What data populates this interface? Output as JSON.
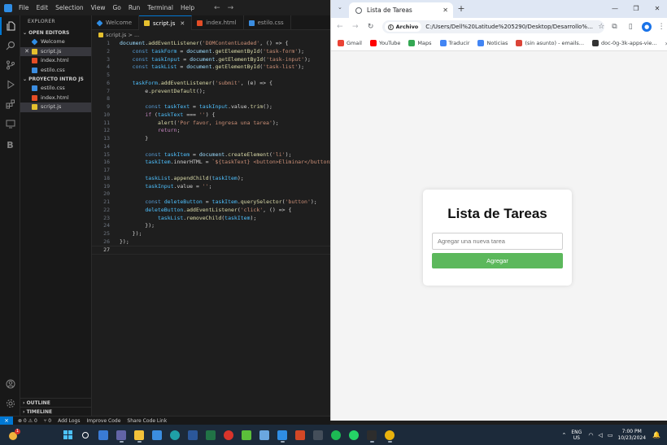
{
  "vscode": {
    "menu": [
      "File",
      "Edit",
      "Selection",
      "View",
      "Go",
      "Run",
      "Terminal",
      "Help"
    ],
    "nav": [
      "←",
      "→"
    ],
    "explorer_title": "EXPLORER",
    "open_editors_title": "OPEN EDITORS",
    "open_editors": [
      {
        "name": "Welcome",
        "icon": "vscode",
        "selected": false,
        "close": false
      },
      {
        "name": "script.js",
        "icon": "js",
        "selected": true,
        "close": true
      },
      {
        "name": "index.html",
        "icon": "html",
        "selected": false,
        "close": false
      },
      {
        "name": "estilo.css",
        "icon": "css",
        "selected": false,
        "close": false
      }
    ],
    "project_title": "PROYECTO INTRO JS",
    "project_files": [
      {
        "name": "estilo.css",
        "icon": "css",
        "selected": false
      },
      {
        "name": "index.html",
        "icon": "html",
        "selected": false
      },
      {
        "name": "script.js",
        "icon": "js",
        "selected": true
      }
    ],
    "outline_title": "OUTLINE",
    "timeline_title": "TIMELINE",
    "tabs": [
      {
        "label": "Welcome",
        "icon": "vscode",
        "active": false
      },
      {
        "label": "script.js",
        "icon": "js",
        "active": true
      },
      {
        "label": "index.html",
        "icon": "html",
        "active": false
      },
      {
        "label": "estilo.css",
        "icon": "css",
        "active": false
      }
    ],
    "breadcrumb": "script.js > ...",
    "code_lines": [
      "document.addEventListener('DOMContentLoaded', () => {",
      "    const taskForm = document.getElementById('task-form');",
      "    const taskInput = document.getElementById('task-input');",
      "    const taskList = document.getElementById('task-list');",
      "",
      "    taskForm.addEventListener('submit', (e) => {",
      "        e.preventDefault();",
      "",
      "        const taskText = taskInput.value.trim();",
      "        if (taskText === '') {",
      "            alert('Por favor, ingresa una tarea');",
      "            return;",
      "        }",
      "",
      "        const taskItem = document.createElement('li');",
      "        taskItem.innerHTML = `${taskText} <button>Eliminar</button>`;",
      "",
      "        taskList.appendChild(taskItem);",
      "        taskInput.value = '';",
      "",
      "        const deleteButton = taskItem.querySelector('button');",
      "        deleteButton.addEventListener('click', () => {",
      "            taskList.removeChild(taskItem);",
      "        });",
      "    });",
      "});",
      ""
    ],
    "current_line": 27,
    "status": {
      "errors": "⊗ 0 ⚠ 0",
      "ports": "⑂ 0",
      "items": [
        "Add Logs",
        "Improve Code",
        "Share Code Link"
      ]
    }
  },
  "chrome": {
    "tab_title": "Lista de Tareas",
    "address_chip": "Archivo",
    "url": "C:/Users/Dell%20Latitude%205290/Desktop/Desarrollo%20d...",
    "bookmarks": [
      {
        "label": "Gmail",
        "color": "#ea4335"
      },
      {
        "label": "YouTube",
        "color": "#ff0000"
      },
      {
        "label": "Maps",
        "color": "#34a853"
      },
      {
        "label": "Traducir",
        "color": "#4285f4"
      },
      {
        "label": "Noticias",
        "color": "#4285f4"
      },
      {
        "label": "(sin asunto) - emails...",
        "color": "#db4437"
      },
      {
        "label": "doc-0g-3k-apps-vie...",
        "color": "#333333"
      }
    ],
    "bookmarks_more": "»",
    "page": {
      "title": "Lista de Tareas",
      "input_placeholder": "Agregar una nueva tarea",
      "button_label": "Agregar",
      "button_color": "#5cb85c"
    }
  },
  "taskbar": {
    "weather_badge": "1",
    "apps": [
      {
        "name": "widgets",
        "color": "#3a7bd5"
      },
      {
        "name": "teams",
        "color": "#6264a7"
      },
      {
        "name": "file-explorer",
        "color": "#f3c13a"
      },
      {
        "name": "store",
        "color": "#3b8de0"
      },
      {
        "name": "edge",
        "color": "#1fa0a7"
      },
      {
        "name": "word",
        "color": "#2b579a"
      },
      {
        "name": "excel",
        "color": "#217346"
      },
      {
        "name": "opera",
        "color": "#d9342b"
      },
      {
        "name": "app-green",
        "color": "#5bbf3a"
      },
      {
        "name": "photos",
        "color": "#6aa7e0"
      },
      {
        "name": "vscode",
        "color": "#2f8de4"
      },
      {
        "name": "powerpoint",
        "color": "#d24726"
      },
      {
        "name": "media",
        "color": "#444e5a"
      },
      {
        "name": "spotify",
        "color": "#1db954"
      },
      {
        "name": "whatsapp",
        "color": "#25d366"
      },
      {
        "name": "terminal",
        "color": "#2d2d2d"
      },
      {
        "name": "chrome",
        "color": "#e8b20d"
      }
    ],
    "lang": [
      "ENG",
      "US"
    ],
    "time": "7:00 PM",
    "date": "10/23/2024"
  }
}
